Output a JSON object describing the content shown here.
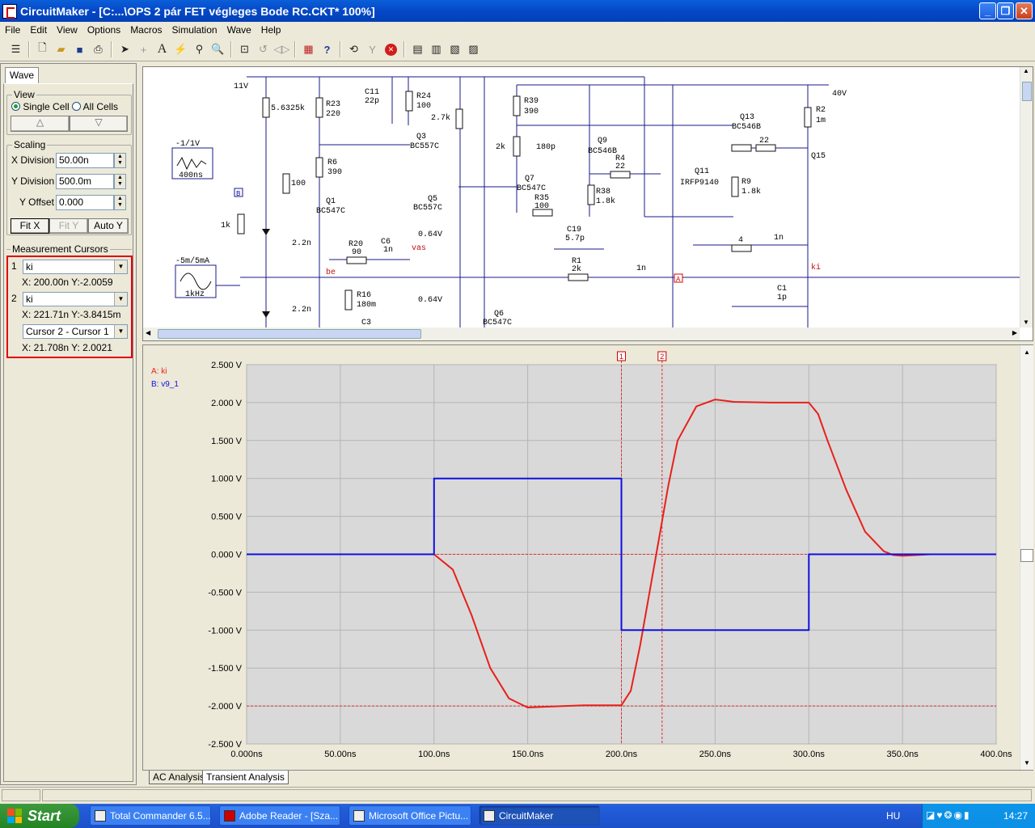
{
  "window": {
    "title": "CircuitMaker - [C:...\\OPS 2 pár FET végleges Bode RC.CKT* 100%]"
  },
  "menu": [
    "File",
    "Edit",
    "View",
    "Options",
    "Macros",
    "Simulation",
    "Wave",
    "Help"
  ],
  "panel": {
    "tab": "Wave",
    "view": {
      "label": "View",
      "single": "Single Cell",
      "all": "All Cells",
      "up": "△",
      "down": "▽"
    },
    "scaling": {
      "label": "Scaling",
      "xdiv_label": "X Division",
      "xdiv": "50.00n",
      "ydiv_label": "Y Division",
      "ydiv": "500.0m",
      "yoff_label": "Y Offset",
      "yoff": "0.000",
      "fitx": "Fit X",
      "fity": "Fit Y",
      "autoy": "Auto Y"
    },
    "cursors": {
      "label": "Measurement Cursors",
      "c1_num": "1",
      "c1_sel": "ki",
      "c1_read": "X: 200.00n  Y:-2.0059",
      "c2_num": "2",
      "c2_sel": "ki",
      "c2_read": "X: 221.71n  Y:-3.8415m",
      "diff_sel": "Cursor 2 - Cursor 1",
      "diff_read": "X: 21.708n  Y: 2.0021"
    }
  },
  "schematic": {
    "labels": [
      "11V",
      "5.6325k",
      "R23",
      "220",
      "C11",
      "22p",
      "R24",
      "100",
      "Q3",
      "BC557C",
      "2.7k",
      "R39",
      "390",
      "Q13",
      "BC546B",
      "40V",
      "R2",
      "1m",
      "-1/1V",
      "400ns",
      "R6",
      "390",
      "Q1",
      "BC547C",
      "100",
      "1k",
      "2.2n",
      "2k",
      "180p",
      "Q9",
      "BC546B",
      "R4",
      "22",
      "Q7",
      "BC547C",
      "Q5",
      "BC557C",
      "0.64V",
      "R35",
      "100",
      "R38",
      "1.8k",
      "Q11",
      "IRFP9140",
      "R9",
      "1.8k",
      "22",
      "Q15",
      "-5m/5mA",
      "1kHz",
      "R20",
      "90",
      "C6",
      "1n",
      "vas",
      "be",
      "C19",
      "5.7p",
      "R1",
      "2k",
      "1n",
      "4",
      "1n",
      "ki",
      "C1",
      "1p",
      "R16",
      "180m",
      "C3",
      "0.64V",
      "Q6",
      "BC547C",
      "2.2n",
      "B",
      "A"
    ]
  },
  "chart_data": {
    "type": "line",
    "legend": [
      "A: ki",
      "B: v9_1"
    ],
    "series": [
      {
        "name": "A: ki",
        "color": "#e8201a",
        "x": [
          0,
          100,
          110,
          120,
          130,
          140,
          150,
          160,
          180,
          195,
          200,
          205,
          210,
          215,
          220,
          225,
          230,
          240,
          250,
          260,
          280,
          295,
          300,
          305,
          310,
          320,
          330,
          340,
          345,
          350,
          365
        ],
        "y": [
          0,
          0,
          -0.2,
          -0.8,
          -1.5,
          -1.9,
          -2.02,
          -2.01,
          -1.99,
          -1.99,
          -1.99,
          -1.8,
          -1.2,
          -0.5,
          0.2,
          0.9,
          1.5,
          1.95,
          2.04,
          2.01,
          2.0,
          2.0,
          2.0,
          1.85,
          1.5,
          0.85,
          0.3,
          0.04,
          -0.01,
          -0.02,
          0
        ]
      },
      {
        "name": "B: v9_1",
        "color": "#1010e0",
        "x": [
          0,
          100,
          100,
          200,
          200,
          300,
          300,
          400
        ],
        "y": [
          0,
          0,
          1,
          1,
          -1,
          -1,
          0,
          0
        ]
      }
    ],
    "xlim": [
      0,
      400
    ],
    "ylim": [
      -2.5,
      2.5
    ],
    "xticks": [
      "0.000ns",
      "50.00ns",
      "100.0ns",
      "150.0ns",
      "200.0ns",
      "250.0ns",
      "300.0ns",
      "350.0ns",
      "400.0ns"
    ],
    "yticks": [
      "2.500 V",
      "2.000 V",
      "1.500 V",
      "1.000 V",
      "0.500 V",
      "0.000 V",
      "-0.500 V",
      "-1.000 V",
      "-1.500 V",
      "-2.000 V",
      "-2.500 V"
    ],
    "cursors": [
      {
        "label": "1",
        "x": 200
      },
      {
        "label": "2",
        "x": 221.71
      }
    ],
    "hlines": [
      0,
      -2.0
    ]
  },
  "bottom_tabs": [
    "AC Analysis",
    "Transient Analysis"
  ],
  "taskbar": {
    "start": "Start",
    "tasks": [
      "Total Commander 6.5...",
      "Adobe Reader - [Sza...",
      "Microsoft Office Pictu...",
      "CircuitMaker"
    ],
    "lang": "HU",
    "clock": "14:27"
  }
}
